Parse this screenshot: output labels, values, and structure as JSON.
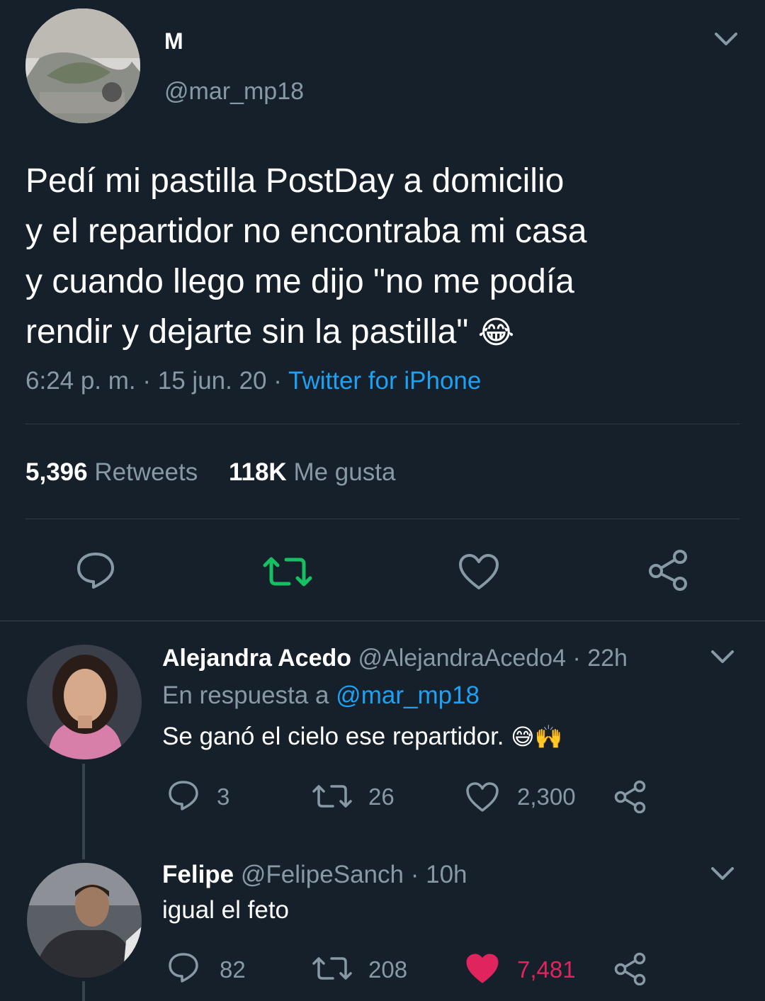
{
  "main_tweet": {
    "display_name": "M",
    "handle": "@mar_mp18",
    "text_lines": [
      "Pedí mi pastilla PostDay a domicilio",
      "y el repartidor no encontraba mi casa",
      "y cuando llego me dijo \"no me podía",
      "rendir y dejarte sin la pastilla\""
    ],
    "emoji": "😂",
    "time": "6:24 p. m.",
    "date": "15 jun. 20",
    "separator": "·",
    "source": "Twitter for iPhone",
    "retweets_count": "5,396",
    "retweets_label": "Retweets",
    "likes_count": "118K",
    "likes_label": "Me gusta"
  },
  "replies": [
    {
      "display_name": "Alejandra Acedo",
      "handle": "@AlejandraAcedo4",
      "time": "22h",
      "reply_to_label": "En respuesta a",
      "reply_to_handle": "@mar_mp18",
      "text": "Se ganó el cielo ese repartidor.",
      "emoji": "😅🙌",
      "reply_count": "3",
      "retweet_count": "26",
      "like_count": "2,300",
      "liked": false
    },
    {
      "display_name": "Felipe",
      "handle": "@FelipeSanch",
      "time": "10h",
      "text": "igual el feto",
      "reply_count": "82",
      "retweet_count": "208",
      "like_count": "7,481",
      "liked": true
    }
  ],
  "icons": {
    "chevron": "chevron-down-icon",
    "reply": "reply-icon",
    "retweet": "retweet-icon",
    "like": "heart-icon",
    "share": "share-icon"
  },
  "colors": {
    "background": "#15202b",
    "text": "#ffffff",
    "muted": "#8899a6",
    "link": "#1da1f2",
    "retweet_green": "#17bf63",
    "like_red": "#e0245e"
  }
}
